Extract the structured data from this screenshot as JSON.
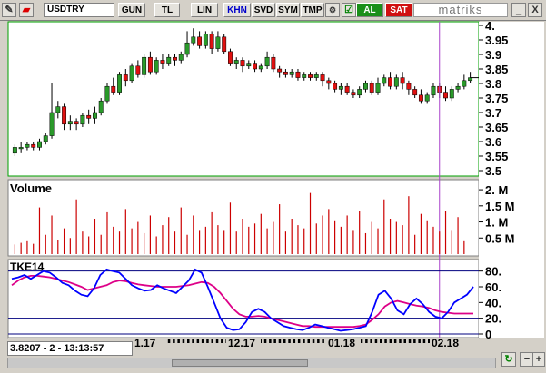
{
  "toolbar": {
    "symbol": "USDTRY",
    "buttons": [
      "GUN",
      "TL",
      "LIN",
      "KHN",
      "SVD",
      "SYM",
      "TMP"
    ],
    "active_button": "KHN",
    "buy_label": "AL",
    "sell_label": "SAT",
    "logo_text": "matriks",
    "minimize": "_",
    "close": "X"
  },
  "status": {
    "readout": "3.8207 - 2 - 13:13:57"
  },
  "colors": {
    "up": "#2a9a2a",
    "down": "#e01010",
    "volume": "#cc0000",
    "tke": "#0000ff",
    "tke_avg": "#dd0088",
    "cursor": "#aa44cc",
    "grid": "#00007f"
  },
  "price_axis": {
    "ticks": [
      "4.",
      "3.95",
      "3.9",
      "3.85",
      "3.8",
      "3.75",
      "3.7",
      "3.65",
      "3.6",
      "3.55",
      "3.5"
    ]
  },
  "volume_panel": {
    "title": "Volume",
    "ticks": [
      "2. M",
      "1.5 M",
      "1. M",
      "0.5 M"
    ]
  },
  "tke_panel": {
    "title": "TKE14",
    "ticks": [
      "80.",
      "60.",
      "40.",
      "20.",
      "0"
    ]
  },
  "date_axis": {
    "labels": [
      "1.17",
      "12.17",
      "01.18",
      "02.18"
    ]
  },
  "chart_data": {
    "type": "candlestick",
    "candles": [
      [
        3.56,
        3.58,
        3.55,
        3.59
      ],
      [
        3.58,
        3.58,
        3.56,
        3.6
      ],
      [
        3.58,
        3.59,
        3.57,
        3.6
      ],
      [
        3.59,
        3.58,
        3.57,
        3.6
      ],
      [
        3.58,
        3.6,
        3.57,
        3.61
      ],
      [
        3.6,
        3.62,
        3.59,
        3.63
      ],
      [
        3.62,
        3.7,
        3.61,
        3.8
      ],
      [
        3.7,
        3.72,
        3.68,
        3.74
      ],
      [
        3.72,
        3.66,
        3.64,
        3.73
      ],
      [
        3.66,
        3.67,
        3.64,
        3.69
      ],
      [
        3.67,
        3.66,
        3.64,
        3.68
      ],
      [
        3.66,
        3.69,
        3.65,
        3.7
      ],
      [
        3.69,
        3.68,
        3.66,
        3.71
      ],
      [
        3.68,
        3.7,
        3.66,
        3.72
      ],
      [
        3.7,
        3.74,
        3.69,
        3.75
      ],
      [
        3.74,
        3.79,
        3.73,
        3.8
      ],
      [
        3.79,
        3.77,
        3.76,
        3.82
      ],
      [
        3.77,
        3.83,
        3.76,
        3.84
      ],
      [
        3.83,
        3.81,
        3.79,
        3.85
      ],
      [
        3.81,
        3.86,
        3.8,
        3.87
      ],
      [
        3.86,
        3.83,
        3.82,
        3.88
      ],
      [
        3.83,
        3.89,
        3.82,
        3.9
      ],
      [
        3.89,
        3.84,
        3.83,
        3.91
      ],
      [
        3.84,
        3.88,
        3.83,
        3.89
      ],
      [
        3.88,
        3.87,
        3.85,
        3.9
      ],
      [
        3.87,
        3.89,
        3.86,
        3.9
      ],
      [
        3.89,
        3.88,
        3.86,
        3.9
      ],
      [
        3.88,
        3.9,
        3.87,
        3.91
      ],
      [
        3.9,
        3.94,
        3.89,
        3.98
      ],
      [
        3.94,
        3.96,
        3.93,
        3.99
      ],
      [
        3.96,
        3.93,
        3.92,
        3.98
      ],
      [
        3.93,
        3.97,
        3.92,
        3.98
      ],
      [
        3.97,
        3.92,
        3.9,
        3.98
      ],
      [
        3.92,
        3.96,
        3.91,
        3.98
      ],
      [
        3.96,
        3.91,
        3.9,
        3.97
      ],
      [
        3.91,
        3.87,
        3.86,
        3.92
      ],
      [
        3.87,
        3.88,
        3.85,
        3.89
      ],
      [
        3.88,
        3.86,
        3.84,
        3.89
      ],
      [
        3.86,
        3.87,
        3.85,
        3.88
      ],
      [
        3.87,
        3.85,
        3.84,
        3.88
      ],
      [
        3.85,
        3.86,
        3.84,
        3.87
      ],
      [
        3.86,
        3.89,
        3.85,
        3.91
      ],
      [
        3.89,
        3.85,
        3.84,
        3.9
      ],
      [
        3.85,
        3.84,
        3.82,
        3.86
      ],
      [
        3.84,
        3.83,
        3.82,
        3.85
      ],
      [
        3.83,
        3.84,
        3.82,
        3.85
      ],
      [
        3.84,
        3.82,
        3.81,
        3.85
      ],
      [
        3.82,
        3.83,
        3.81,
        3.84
      ],
      [
        3.83,
        3.82,
        3.81,
        3.84
      ],
      [
        3.82,
        3.83,
        3.81,
        3.84
      ],
      [
        3.83,
        3.81,
        3.79,
        3.84
      ],
      [
        3.81,
        3.8,
        3.78,
        3.82
      ],
      [
        3.8,
        3.78,
        3.77,
        3.81
      ],
      [
        3.78,
        3.79,
        3.76,
        3.8
      ],
      [
        3.79,
        3.77,
        3.76,
        3.8
      ],
      [
        3.77,
        3.76,
        3.75,
        3.78
      ],
      [
        3.76,
        3.78,
        3.75,
        3.79
      ],
      [
        3.78,
        3.8,
        3.77,
        3.81
      ],
      [
        3.8,
        3.77,
        3.76,
        3.81
      ],
      [
        3.77,
        3.8,
        3.76,
        3.82
      ],
      [
        3.8,
        3.82,
        3.79,
        3.83
      ],
      [
        3.82,
        3.79,
        3.78,
        3.84
      ],
      [
        3.79,
        3.82,
        3.78,
        3.83
      ],
      [
        3.82,
        3.8,
        3.78,
        3.84
      ],
      [
        3.8,
        3.78,
        3.76,
        3.81
      ],
      [
        3.78,
        3.76,
        3.75,
        3.79
      ],
      [
        3.76,
        3.74,
        3.73,
        3.78
      ],
      [
        3.74,
        3.76,
        3.73,
        3.77
      ],
      [
        3.76,
        3.79,
        3.75,
        3.8
      ],
      [
        3.79,
        3.77,
        3.75,
        3.8
      ],
      [
        3.77,
        3.75,
        3.74,
        3.79
      ],
      [
        3.75,
        3.78,
        3.74,
        3.79
      ],
      [
        3.78,
        3.79,
        3.77,
        3.8
      ],
      [
        3.79,
        3.81,
        3.78,
        3.83
      ],
      [
        3.81,
        3.82,
        3.8,
        3.84
      ]
    ],
    "volume": [
      0.3,
      0.35,
      0.4,
      0.32,
      1.45,
      0.6,
      1.2,
      0.45,
      0.8,
      0.5,
      1.7,
      0.7,
      0.55,
      1.1,
      0.6,
      1.3,
      0.85,
      0.7,
      1.4,
      0.8,
      1.0,
      0.65,
      1.2,
      0.55,
      0.9,
      1.15,
      0.7,
      1.45,
      0.6,
      1.2,
      0.75,
      0.85,
      1.3,
      0.9,
      0.75,
      1.6,
      0.7,
      1.1,
      0.85,
      0.95,
      1.25,
      0.8,
      1.0,
      1.55,
      0.7,
      1.1,
      0.9,
      0.8,
      1.9,
      0.95,
      1.2,
      1.4,
      1.05,
      0.85,
      1.2,
      0.75,
      1.35,
      0.65,
      1.0,
      0.8,
      1.7,
      1.1,
      1.0,
      0.9,
      1.8,
      0.6,
      1.25,
      1.05,
      0.85,
      0.7,
      1.35,
      0.75,
      1.15,
      0.4
    ],
    "tke": [
      70,
      72,
      75,
      70,
      75,
      80,
      78,
      72,
      65,
      62,
      55,
      50,
      48,
      58,
      75,
      82,
      80,
      78,
      70,
      62,
      58,
      55,
      56,
      62,
      58,
      55,
      52,
      60,
      68,
      82,
      78,
      60,
      40,
      20,
      8,
      5,
      6,
      15,
      28,
      32,
      28,
      20,
      15,
      10,
      8,
      6,
      5,
      8,
      12,
      10,
      8,
      6,
      4,
      5,
      6,
      8,
      10,
      28,
      50,
      55,
      45,
      30,
      25,
      38,
      45,
      38,
      28,
      22,
      20,
      28,
      40,
      45,
      50,
      60
    ],
    "tke_avg": [
      62,
      68,
      72,
      74,
      74,
      73,
      72,
      70,
      68,
      66,
      63,
      60,
      56,
      58,
      60,
      62,
      66,
      68,
      67,
      65,
      63,
      62,
      61,
      60,
      60,
      60,
      60,
      61,
      62,
      64,
      66,
      65,
      60,
      52,
      42,
      32,
      25,
      22,
      22,
      23,
      22,
      20,
      18,
      16,
      14,
      12,
      10,
      10,
      9,
      9,
      9,
      9,
      9,
      9,
      9,
      10,
      12,
      18,
      25,
      35,
      40,
      42,
      40,
      38,
      36,
      35,
      33,
      30,
      28,
      27,
      26,
      26,
      26,
      26
    ],
    "cursor_index": 69,
    "current_price": 3.82,
    "price_ylim": [
      3.5,
      4.0
    ],
    "volume_ylim": [
      0,
      2.2
    ],
    "tke_ylim": [
      0,
      90
    ],
    "tke_lines": [
      80,
      20,
      0
    ]
  }
}
